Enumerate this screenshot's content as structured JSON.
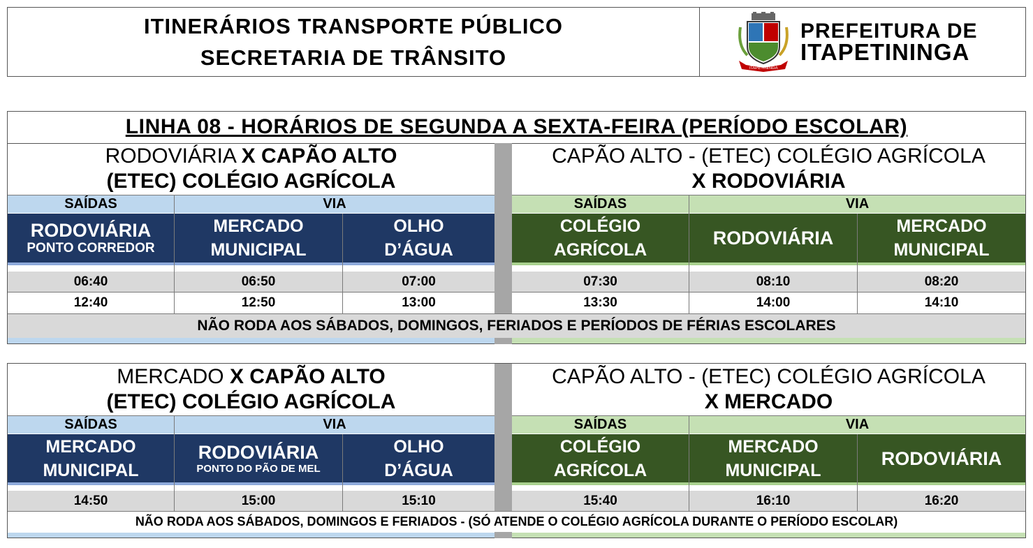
{
  "header": {
    "title_line1": "ITINERÁRIOS TRANSPORTE PÚBLICO",
    "title_line2": "SECRETARIA DE TRÂNSITO",
    "logo_line1": "PREFEITURA DE",
    "logo_line2": "ITAPETININGA",
    "crest_icon": "city-crest-icon",
    "crest_ribbon": "ITAPETININGA"
  },
  "colors": {
    "dark_blue": "#1f3864",
    "light_blue": "#bdd7ee",
    "dark_green": "#375623",
    "light_green": "#c5e0b4",
    "grey": "#d9d9d9"
  },
  "table1": {
    "title": "LINHA 08 - HORÁRIOS DE SEGUNDA A SEXTA-FEIRA (PERÍODO ESCOLAR)",
    "left": {
      "route_line1_normal": "RODOVIÁRIA ",
      "route_line1_bold": "X CAPÃO ALTO",
      "route_line2": "(ETEC) COLÉGIO AGRÍCOLA",
      "saidas": "SAÍDAS",
      "via": "VIA",
      "col1_main": "RODOVIÁRIA",
      "col1_sub": "PONTO CORREDOR",
      "col2_l1": "MERCADO",
      "col2_l2": "MUNICIPAL",
      "col3_l1": "OLHO",
      "col3_l2": "D’ÁGUA",
      "rows": [
        [
          "06:40",
          "06:50",
          "07:00"
        ],
        [
          "12:40",
          "12:50",
          "13:00"
        ]
      ]
    },
    "right": {
      "route_line1": "CAPÃO ALTO - (ETEC) COLÉGIO AGRÍCOLA",
      "route_line2": "X RODOVIÁRIA",
      "saidas": "SAÍDAS",
      "via": "VIA",
      "col1_l1": "COLÉGIO",
      "col1_l2": "AGRÍCOLA",
      "col2": "RODOVIÁRIA",
      "col3_l1": "MERCADO",
      "col3_l2": "MUNICIPAL",
      "rows": [
        [
          "07:30",
          "08:10",
          "08:20"
        ],
        [
          "13:30",
          "14:00",
          "14:10"
        ]
      ]
    },
    "note": "NÃO RODA  AOS SÁBADOS, DOMINGOS, FERIADOS E PERÍODOS DE FÉRIAS ESCOLARES"
  },
  "table2": {
    "left": {
      "route_line1_normal": "MERCADO ",
      "route_line1_bold": "X CAPÃO ALTO",
      "route_line2": "(ETEC) COLÉGIO AGRÍCOLA",
      "saidas": "SAÍDAS",
      "via": "VIA",
      "col1_l1": "MERCADO",
      "col1_l2": "MUNICIPAL",
      "col2_main": "RODOVIÁRIA",
      "col2_sub": "PONTO DO PÃO DE MEL",
      "col3_l1": "OLHO",
      "col3_l2": "D’ÁGUA",
      "rows": [
        [
          "14:50",
          "15:00",
          "15:10"
        ]
      ]
    },
    "right": {
      "route_line1": "CAPÃO ALTO - (ETEC) COLÉGIO AGRÍCOLA",
      "route_line2": "X MERCADO",
      "saidas": "SAÍDAS",
      "via": "VIA",
      "col1_l1": "COLÉGIO",
      "col1_l2": "AGRÍCOLA",
      "col2_l1": "MERCADO",
      "col2_l2": "MUNICIPAL",
      "col3": "RODOVIÁRIA",
      "rows": [
        [
          "15:40",
          "16:10",
          "16:20"
        ]
      ]
    },
    "note": "NÃO RODA AOS SÁBADOS, DOMINGOS E FERIADOS - (SÓ ATENDE O COLÉGIO AGRÍCOLA DURANTE O PERÍODO ESCOLAR)"
  }
}
